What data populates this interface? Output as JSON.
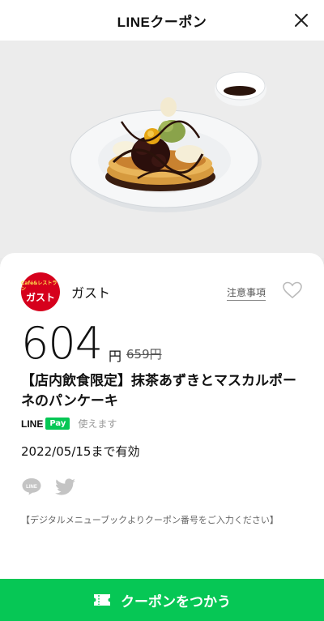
{
  "header": {
    "title": "LINEクーポン"
  },
  "coupon": {
    "shop_logo_top": "Café&レストラン",
    "shop_logo_main": "ガスト",
    "shop_name": "ガスト",
    "notes_label": "注意事項",
    "price": "604",
    "price_unit": "円",
    "original_price": "659円",
    "title": "【店内飲食限定】抹茶あずきとマスカルポーネのパンケーキ",
    "linepay_line": "LINE",
    "linepay_pay": "Pay",
    "linepay_note": "使えます",
    "expiry": "2022/05/15まで有効",
    "instructions": "【デジタルメニューブックよりクーポン番号をご入力ください】"
  },
  "action": {
    "use_label": "クーポンをつかう"
  },
  "colors": {
    "line_green": "#06c755",
    "brand_red": "#d6001c"
  }
}
